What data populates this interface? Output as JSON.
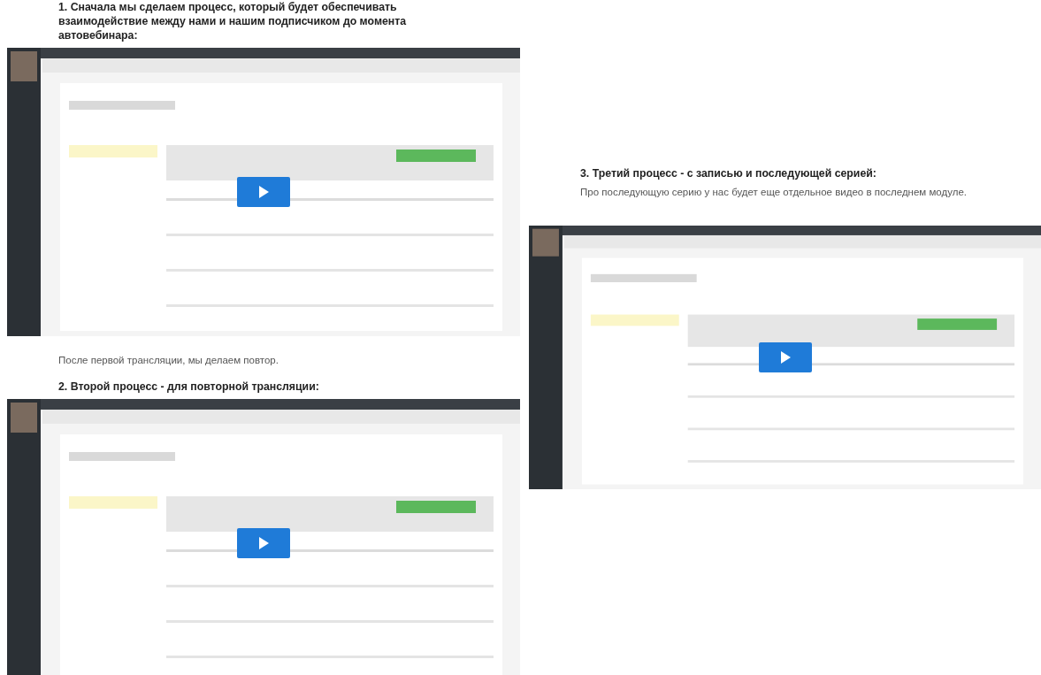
{
  "left": [
    {
      "kind": "heading",
      "text": "1. Сначала мы сделаем процесс, который будет обеспечивать взаимодействие между нами и нашим подписчиком до момента автовебинара:"
    },
    {
      "kind": "video"
    },
    {
      "kind": "paragraph",
      "text": "После первой трансляции, мы делаем повтор."
    },
    {
      "kind": "heading",
      "text": "2. Второй процесс - для повторной трансляции:"
    },
    {
      "kind": "video"
    }
  ],
  "right": [
    {
      "kind": "heading",
      "text": "3. Третий процесс - с записью и последующей серией:"
    },
    {
      "kind": "paragraph",
      "text": "Про последующую серию у нас будет еще отдельное видео в последнем модуле."
    },
    {
      "kind": "video"
    }
  ]
}
